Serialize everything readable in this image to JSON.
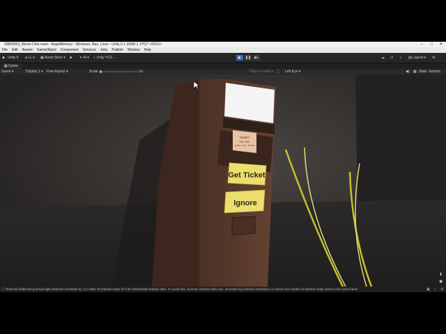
{
  "window_title": "33859933_Movie-Cfee-main - AngelMemory - Windows, Mac, Linux - Unity 6.1 (6000.1.17f1)* <DX11>",
  "menu": [
    "File",
    "Edit",
    "Assets",
    "GameObject",
    "Component",
    "Services",
    "Jobs",
    "Publish",
    "Window",
    "Help"
  ],
  "toolbar": {
    "unity": "Unity 6",
    "account": "LL",
    "asset_store": "Asset Store",
    "ai": "AI",
    "vcs": "Unity VCS",
    "layout": "Layout"
  },
  "tab": {
    "label": "Game"
  },
  "gamebar": {
    "mode": "Game",
    "display": "Display 1",
    "aspect": "Free Aspect",
    "scale_label": "Scale",
    "scale_value": "1x",
    "play_mode": "Play Focused",
    "eye": "Left Eye",
    "stats": "Stats",
    "gizmos": "Gizmos"
  },
  "scene": {
    "sign_line1": "TICKET",
    "sign_line2": "ONE WAY",
    "sign_line3": "ADMIT ONE - MOVIE",
    "button_get_ticket": "Get Ticket",
    "button_ignore": "Ignore"
  },
  "status_message": "Reduced additional punctual light shadows resolution by 4 to make 35 shadow maps fit in the 2048x2048 shadow atlas. To avoid this, increase shadow atlas size, decrease big shadow resolutions, or reduce the number of shadow maps active in the same frame",
  "colors": {
    "play_active": "#3c6db5",
    "machine_front": "#5a3a2c",
    "button_yellow": "#ecdf6e",
    "grass": "#c9c229"
  }
}
